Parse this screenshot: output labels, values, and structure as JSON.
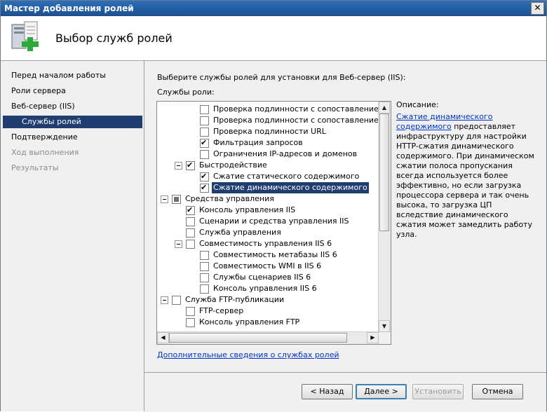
{
  "window": {
    "title": "Мастер добавления ролей",
    "close_glyph": "✕"
  },
  "header": {
    "title": "Выбор служб ролей",
    "icon": "server-roles-add-icon"
  },
  "sidebar": {
    "steps": [
      {
        "label": "Перед началом работы"
      },
      {
        "label": "Роли сервера"
      },
      {
        "label": "Веб-сервер (IIS)"
      },
      {
        "label": "Службы ролей"
      },
      {
        "label": "Подтверждение"
      },
      {
        "label": "Ход выполнения"
      },
      {
        "label": "Результаты"
      }
    ]
  },
  "main": {
    "instruction": "Выберите службы ролей для установки для Веб-сервер (IIS):",
    "services_label": "Службы роли:",
    "more_info_link": "Дополнительные сведения о службах ролей"
  },
  "tree": {
    "nodes": [
      {
        "label": "Проверка подлинности с сопоставлением серт",
        "state": "unchecked"
      },
      {
        "label": "Проверка подлинности с сопоставлением серт",
        "state": "unchecked"
      },
      {
        "label": "Проверка подлинности URL",
        "state": "unchecked"
      },
      {
        "label": "Фильтрация запросов",
        "state": "checked"
      },
      {
        "label": "Ограничения IP-адресов и доменов",
        "state": "unchecked"
      },
      {
        "label": "Быстродействие",
        "state": "checked"
      },
      {
        "label": "Сжатие статического содержимого",
        "state": "checked"
      },
      {
        "label": "Сжатие динамического содержимого",
        "state": "checked",
        "selected": true
      },
      {
        "label": "Средства управления",
        "state": "partial"
      },
      {
        "label": "Консоль управления IIS",
        "state": "checked"
      },
      {
        "label": "Сценарии и средства управления IIS",
        "state": "unchecked"
      },
      {
        "label": "Служба управления",
        "state": "unchecked"
      },
      {
        "label": "Совместимость управления IIS 6",
        "state": "unchecked"
      },
      {
        "label": "Совместимость метабазы IIS 6",
        "state": "unchecked"
      },
      {
        "label": "Совместимость WMI в IIS 6",
        "state": "unchecked"
      },
      {
        "label": "Службы сценариев IIS 6",
        "state": "unchecked"
      },
      {
        "label": "Консоль управления IIS 6",
        "state": "unchecked"
      },
      {
        "label": "Служба FTP-публикации",
        "state": "unchecked"
      },
      {
        "label": "FTP-сервер",
        "state": "unchecked"
      },
      {
        "label": "Консоль управления FTP",
        "state": "unchecked"
      }
    ]
  },
  "description": {
    "label": "Описание:",
    "link": "Сжатие динамического содержимого",
    "text": "предоставляет инфраструктуру для настройки HTTP-сжатия динамического содержимого. При динамическом сжатии полоса пропускания всегда используется более эффективно, но если загрузка процессора сервера и так очень высока, то загрузка ЦП вследствие динамического сжатия может замедлить работу узла."
  },
  "buttons": {
    "back": "< Назад",
    "next": "Далее >",
    "install": "Установить",
    "cancel": "Отмена"
  }
}
